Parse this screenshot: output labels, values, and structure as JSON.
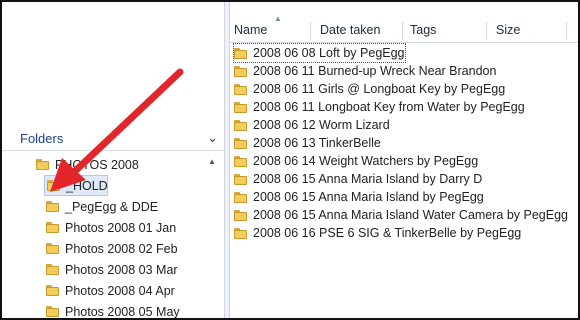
{
  "left_pane": {
    "section_label": "Folders",
    "items": [
      {
        "label": "PHOTOS 2008"
      },
      {
        "label": "_HOLD"
      },
      {
        "label": "_PegEgg & DDE"
      },
      {
        "label": "Photos 2008 01 Jan"
      },
      {
        "label": "Photos 2008 02 Feb"
      },
      {
        "label": "Photos 2008 03 Mar"
      },
      {
        "label": "Photos 2008 04 Apr"
      },
      {
        "label": "Photos 2008 05 May"
      }
    ]
  },
  "columns": {
    "name": "Name",
    "date_taken": "Date taken",
    "tags": "Tags",
    "size": "Size"
  },
  "files": [
    {
      "name": "2008 06 08 Loft by PegEgg"
    },
    {
      "name": "2008 06 11 Burned-up Wreck Near Brandon"
    },
    {
      "name": "2008 06 11 Girls @ Longboat Key by PegEgg"
    },
    {
      "name": "2008 06 11 Longboat Key from Water by PegEgg"
    },
    {
      "name": "2008 06 12 Worm Lizard"
    },
    {
      "name": "2008 06 13 TinkerBelle"
    },
    {
      "name": "2008 06 14 Weight Watchers by PegEgg"
    },
    {
      "name": "2008 06 15 Anna Maria Island by Darry D"
    },
    {
      "name": "2008 06 15 Anna Maria Island by PegEgg"
    },
    {
      "name": "2008 06 15 Anna Maria Island Water Camera by PegEgg"
    },
    {
      "name": "2008 06 16 PSE 6 SIG & TinkerBelle by PegEgg"
    }
  ],
  "colors": {
    "arrow": "#e3262b",
    "folder": "#f3cc5c",
    "folders_label": "#1e3f8a"
  }
}
